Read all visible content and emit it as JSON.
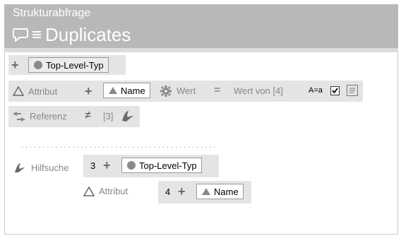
{
  "header": {
    "subtitle": "Strukturabfrage",
    "title": "Duplicates"
  },
  "row1": {
    "type_label": "Top-Level-Typ"
  },
  "row2": {
    "attr_label": "Attribut",
    "name_chip": "Name",
    "wert_label": "Wert",
    "equals": "=",
    "wert_von": "Wert von [4]",
    "case_label": "A=a"
  },
  "row3": {
    "ref_label": "Referenz",
    "neq": "≠",
    "ref_value": "[3]"
  },
  "hilf": {
    "label": "Hilfsuche",
    "num": "3",
    "type_label": "Top-Level-Typ"
  },
  "hilf_attr": {
    "label": "Attribut",
    "num": "4",
    "name_chip": "Name"
  }
}
